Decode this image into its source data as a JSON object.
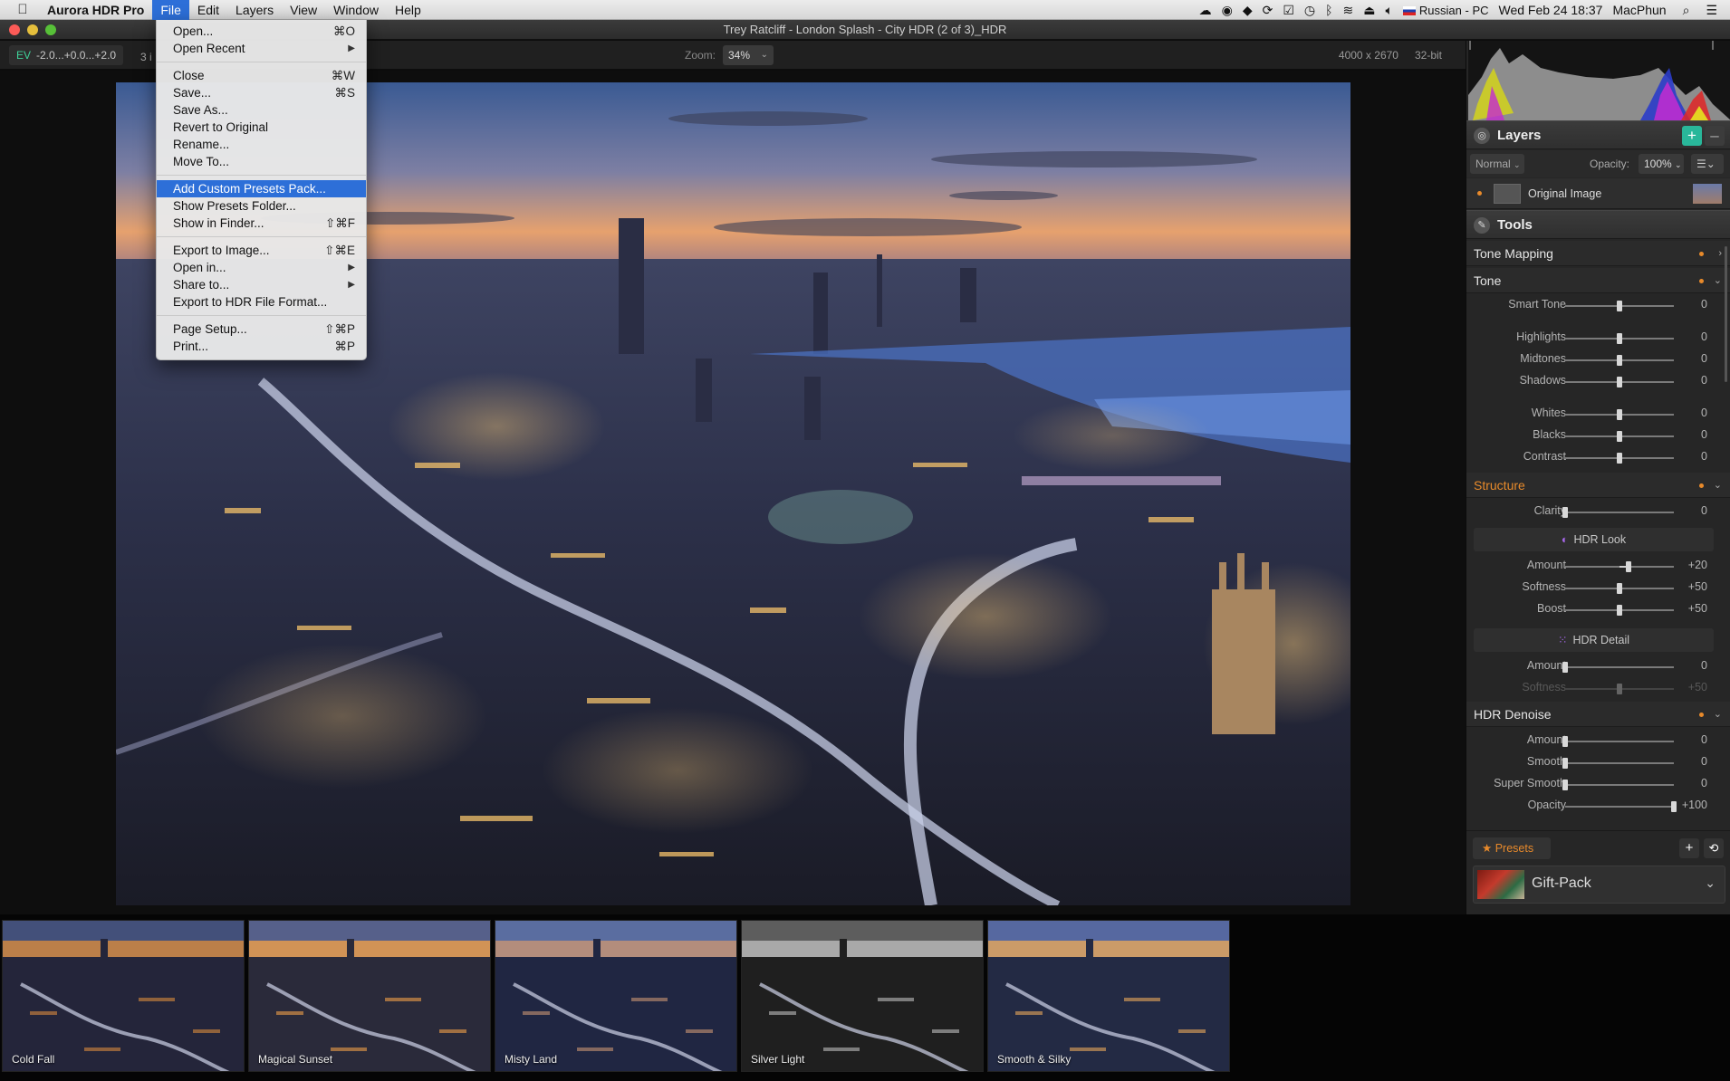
{
  "menubar": {
    "app_name": "Aurora HDR Pro",
    "menus": [
      "File",
      "Edit",
      "Layers",
      "View",
      "Window",
      "Help"
    ],
    "status": {
      "input_source": "Russian - PC",
      "datetime": "Wed Feb 24  18:37",
      "user": "MacPhun"
    }
  },
  "window": {
    "title": "Trey Ratcliff - London Splash - City HDR (2 of 3)_HDR"
  },
  "toolbar": {
    "ev_label": "EV",
    "ev_values": "-2.0...+0.0...+2.0",
    "image_count": "3 i",
    "zoom_label": "Zoom:",
    "zoom_value": "34%",
    "dimensions": "4000 x 2670",
    "bit_depth": "32-bit"
  },
  "file_menu": {
    "items": [
      {
        "label": "Open...",
        "shortcut": "⌘O"
      },
      {
        "label": "Open Recent",
        "submenu": true
      },
      {
        "sep": true
      },
      {
        "label": "Close",
        "shortcut": "⌘W"
      },
      {
        "label": "Save...",
        "shortcut": "⌘S"
      },
      {
        "label": "Save As..."
      },
      {
        "label": "Revert to Original"
      },
      {
        "label": "Rename..."
      },
      {
        "label": "Move To..."
      },
      {
        "sep": true
      },
      {
        "label": "Add Custom Presets Pack...",
        "highlighted": true
      },
      {
        "label": "Show Presets Folder..."
      },
      {
        "label": "Show in Finder...",
        "shortcut": "⇧⌘F"
      },
      {
        "sep": true
      },
      {
        "label": "Export to Image...",
        "shortcut": "⇧⌘E"
      },
      {
        "label": "Open in...",
        "submenu": true
      },
      {
        "label": "Share to...",
        "submenu": true
      },
      {
        "label": "Export to HDR File Format..."
      },
      {
        "sep": true
      },
      {
        "label": "Page Setup...",
        "shortcut": "⇧⌘P"
      },
      {
        "label": "Print...",
        "shortcut": "⌘P"
      }
    ]
  },
  "layers": {
    "title": "Layers",
    "blend_mode": "Normal",
    "opacity_label": "Opacity:",
    "opacity_value": "100%",
    "layer_name": "Original Image"
  },
  "tools": {
    "title": "Tools",
    "sections": {
      "tone_mapping": "Tone Mapping",
      "tone": "Tone",
      "structure": "Structure",
      "hdr_look": "HDR Look",
      "hdr_detail": "HDR Detail",
      "hdr_denoise": "HDR Denoise"
    },
    "sliders": {
      "smart_tone": {
        "label": "Smart Tone",
        "value": "0",
        "pos": 0.5
      },
      "highlights": {
        "label": "Highlights",
        "value": "0",
        "pos": 0.5
      },
      "midtones": {
        "label": "Midtones",
        "value": "0",
        "pos": 0.5
      },
      "shadows": {
        "label": "Shadows",
        "value": "0",
        "pos": 0.5
      },
      "whites": {
        "label": "Whites",
        "value": "0",
        "pos": 0.5
      },
      "blacks": {
        "label": "Blacks",
        "value": "0",
        "pos": 0.5
      },
      "contrast": {
        "label": "Contrast",
        "value": "0",
        "pos": 0.5
      },
      "clarity": {
        "label": "Clarity",
        "value": "0",
        "pos": 0.0
      },
      "look_amount": {
        "label": "Amount",
        "value": "+20",
        "pos": 0.58
      },
      "look_softness": {
        "label": "Softness",
        "value": "+50",
        "pos": 0.5
      },
      "look_boost": {
        "label": "Boost",
        "value": "+50",
        "pos": 0.5
      },
      "detail_amount": {
        "label": "Amount",
        "value": "0",
        "pos": 0.0
      },
      "detail_softness": {
        "label": "Softness",
        "value": "+50",
        "pos": 0.5
      },
      "denoise_amount": {
        "label": "Amount",
        "value": "0",
        "pos": 0.0
      },
      "denoise_smooth": {
        "label": "Smooth",
        "value": "0",
        "pos": 0.0
      },
      "denoise_super_smooth": {
        "label": "Super Smooth",
        "value": "0",
        "pos": 0.0
      },
      "denoise_opacity": {
        "label": "Opacity",
        "value": "+100",
        "pos": 1.0
      }
    }
  },
  "presets": {
    "button_label": "Presets",
    "pack_name": "Gift-Pack"
  },
  "filmstrip": [
    {
      "label": "Cold Fall"
    },
    {
      "label": "Magical Sunset"
    },
    {
      "label": "Misty Land"
    },
    {
      "label": "Silver Light"
    },
    {
      "label": "Smooth & Silky"
    }
  ],
  "colors": {
    "accent": "#2d6fd8",
    "orange": "#e88a2b",
    "teal": "#29b79a"
  },
  "icons": [
    "apple-icon",
    "wifi-icon",
    "bluetooth-icon",
    "volume-icon",
    "spotlight-search-icon",
    "notification-center-icon",
    "layers-icon",
    "tools-icon",
    "star-icon",
    "hdr-look-icon",
    "hdr-detail-icon",
    "plus-icon",
    "minus-icon",
    "list-menu-icon",
    "sync-icon"
  ]
}
